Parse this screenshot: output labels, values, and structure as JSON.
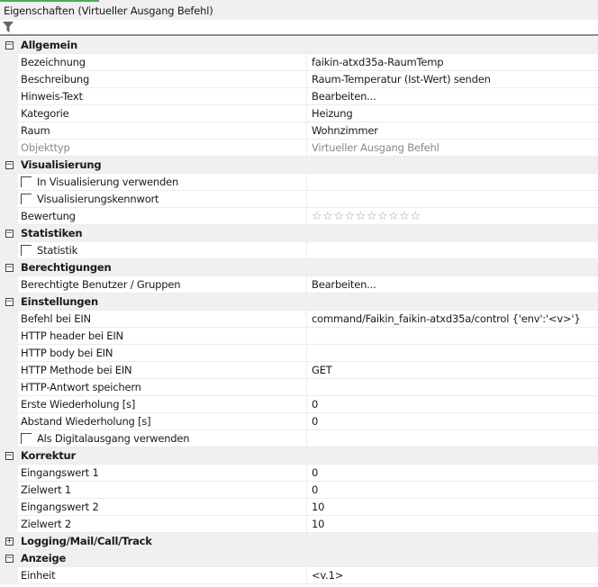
{
  "window": {
    "title": "Eigenschaften (Virtueller Ausgang Befehl)",
    "filter_icon": "filter-icon"
  },
  "sections": [
    {
      "label": "Allgemein",
      "expanded": true,
      "rows": [
        {
          "name": "Bezeichnung",
          "value": "faikin-atxd35a-RaumTemp"
        },
        {
          "name": "Beschreibung",
          "value": "Raum-Temperatur (Ist-Wert) senden"
        },
        {
          "name": "Hinweis-Text",
          "value": "Bearbeiten..."
        },
        {
          "name": "Kategorie",
          "value": "Heizung"
        },
        {
          "name": "Raum",
          "value": "Wohnzimmer"
        },
        {
          "name": "Objekttyp",
          "value": "Virtueller Ausgang Befehl",
          "disabled": true
        }
      ]
    },
    {
      "label": "Visualisierung",
      "expanded": true,
      "rows": [
        {
          "name": "In Visualisierung verwenden",
          "checkbox": true,
          "value": ""
        },
        {
          "name": "Visualisierungskennwort",
          "checkbox": true,
          "value": ""
        },
        {
          "name": "Bewertung",
          "rating": 0,
          "rating_max": 10
        }
      ]
    },
    {
      "label": "Statistiken",
      "expanded": true,
      "rows": [
        {
          "name": "Statistik",
          "checkbox": true,
          "value": ""
        }
      ]
    },
    {
      "label": "Berechtigungen",
      "expanded": true,
      "rows": [
        {
          "name": "Berechtigte Benutzer / Gruppen",
          "value": "Bearbeiten..."
        }
      ]
    },
    {
      "label": "Einstellungen",
      "expanded": true,
      "rows": [
        {
          "name": "Befehl bei EIN",
          "value": "command/Faikin_faikin-atxd35a/control {'env':'<v>'}"
        },
        {
          "name": "HTTP header bei EIN",
          "value": ""
        },
        {
          "name": "HTTP body bei EIN",
          "value": ""
        },
        {
          "name": "HTTP Methode bei EIN",
          "value": "GET"
        },
        {
          "name": "HTTP-Antwort speichern",
          "value": ""
        },
        {
          "name": "Erste Wiederholung [s]",
          "value": "0"
        },
        {
          "name": "Abstand Wiederholung [s]",
          "value": "0"
        },
        {
          "name": "Als Digitalausgang verwenden",
          "checkbox": true,
          "value": ""
        }
      ]
    },
    {
      "label": "Korrektur",
      "expanded": true,
      "rows": [
        {
          "name": "Eingangswert 1",
          "value": "0"
        },
        {
          "name": "Zielwert 1",
          "value": "0"
        },
        {
          "name": "Eingangswert 2",
          "value": "10"
        },
        {
          "name": "Zielwert 2",
          "value": "10"
        }
      ]
    },
    {
      "label": "Logging/Mail/Call/Track",
      "expanded": false,
      "rows": []
    },
    {
      "label": "Anzeige",
      "expanded": true,
      "rows": [
        {
          "name": "Einheit",
          "value": "<v.1>"
        }
      ]
    }
  ]
}
